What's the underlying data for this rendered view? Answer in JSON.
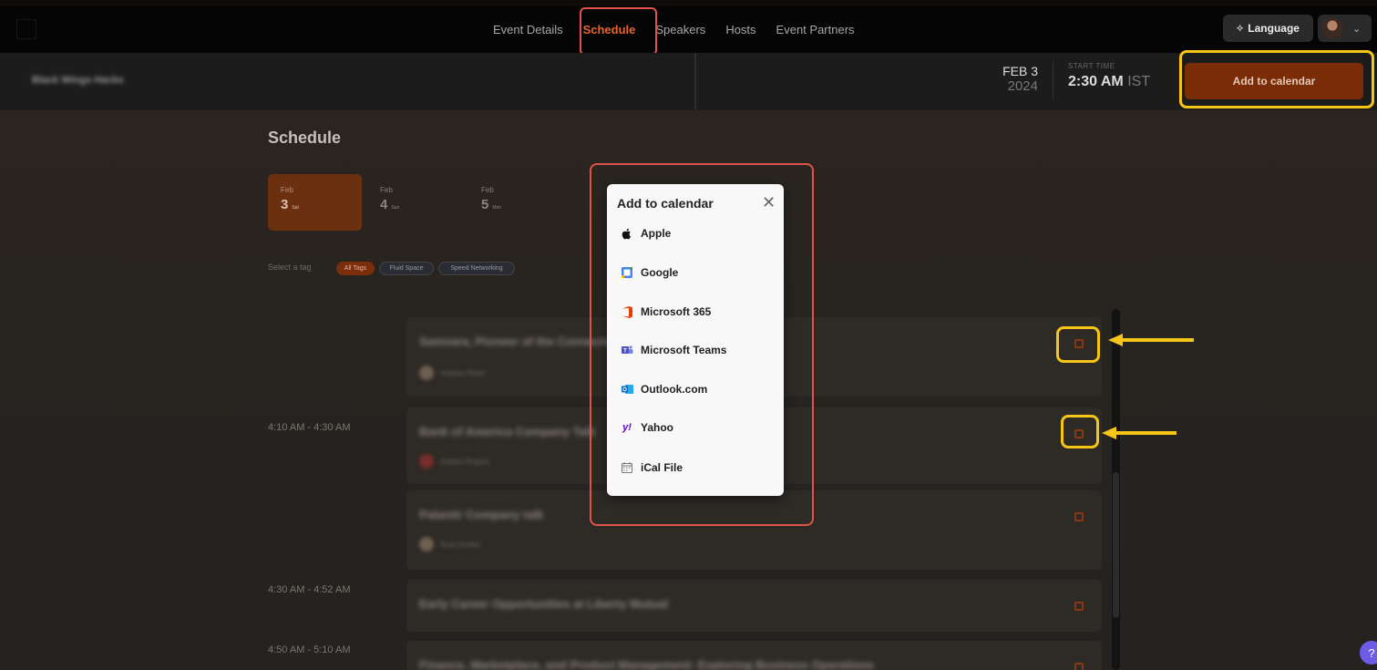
{
  "nav": {
    "tabs": [
      "Event Details",
      "Schedule",
      "Speakers",
      "Hosts",
      "Event Partners"
    ],
    "active_tab": "Schedule",
    "language_label": "Language"
  },
  "event": {
    "title": "Black Wings Hacks",
    "date_month_day": "FEB 3",
    "date_year": "2024",
    "start_time_label": "START TIME",
    "start_time": "2:30 AM",
    "timezone": "IST",
    "add_to_calendar_label": "Add to calendar"
  },
  "schedule": {
    "heading": "Schedule",
    "dates": [
      {
        "month": "Feb",
        "day": "3",
        "dow": "Sat",
        "active": true
      },
      {
        "month": "Feb",
        "day": "4",
        "dow": "Sun",
        "active": false
      },
      {
        "month": "Feb",
        "day": "5",
        "dow": "Mon",
        "active": false
      }
    ],
    "tag_label": "Select a tag",
    "tags": [
      "All Tags",
      "Fluid Space",
      "Speed Networking"
    ],
    "time_slots": [
      "4:10 AM - 4:30 AM",
      "4:30 AM - 4:52 AM",
      "4:50 AM - 5:10 AM"
    ],
    "sessions": [
      {
        "title": "Samsara, Pioneer of the Connected Operations Cloud",
        "speaker": "Andrew Reed"
      },
      {
        "title": "Bank of America Company Talk",
        "speaker": "Andrea Rogers"
      },
      {
        "title": "Palantir Company talk",
        "speaker": "Ryan Ansley"
      },
      {
        "title": "Early Career Opportunities at Liberty Mutual",
        "speaker": ""
      },
      {
        "title": "Finance, Marketplace, and Product Management: Exploring Business Operations",
        "speaker": ""
      }
    ]
  },
  "modal": {
    "title": "Add to calendar",
    "close_label": "✕",
    "options": [
      "Apple",
      "Google",
      "Microsoft 365",
      "Microsoft Teams",
      "Outlook.com",
      "Yahoo",
      "iCal File"
    ]
  },
  "help_label": "?",
  "colors": {
    "accent": "#e8642f",
    "button_bg": "#7a2c07",
    "highlight_red": "#e0534a",
    "highlight_yellow": "#f5c518"
  }
}
